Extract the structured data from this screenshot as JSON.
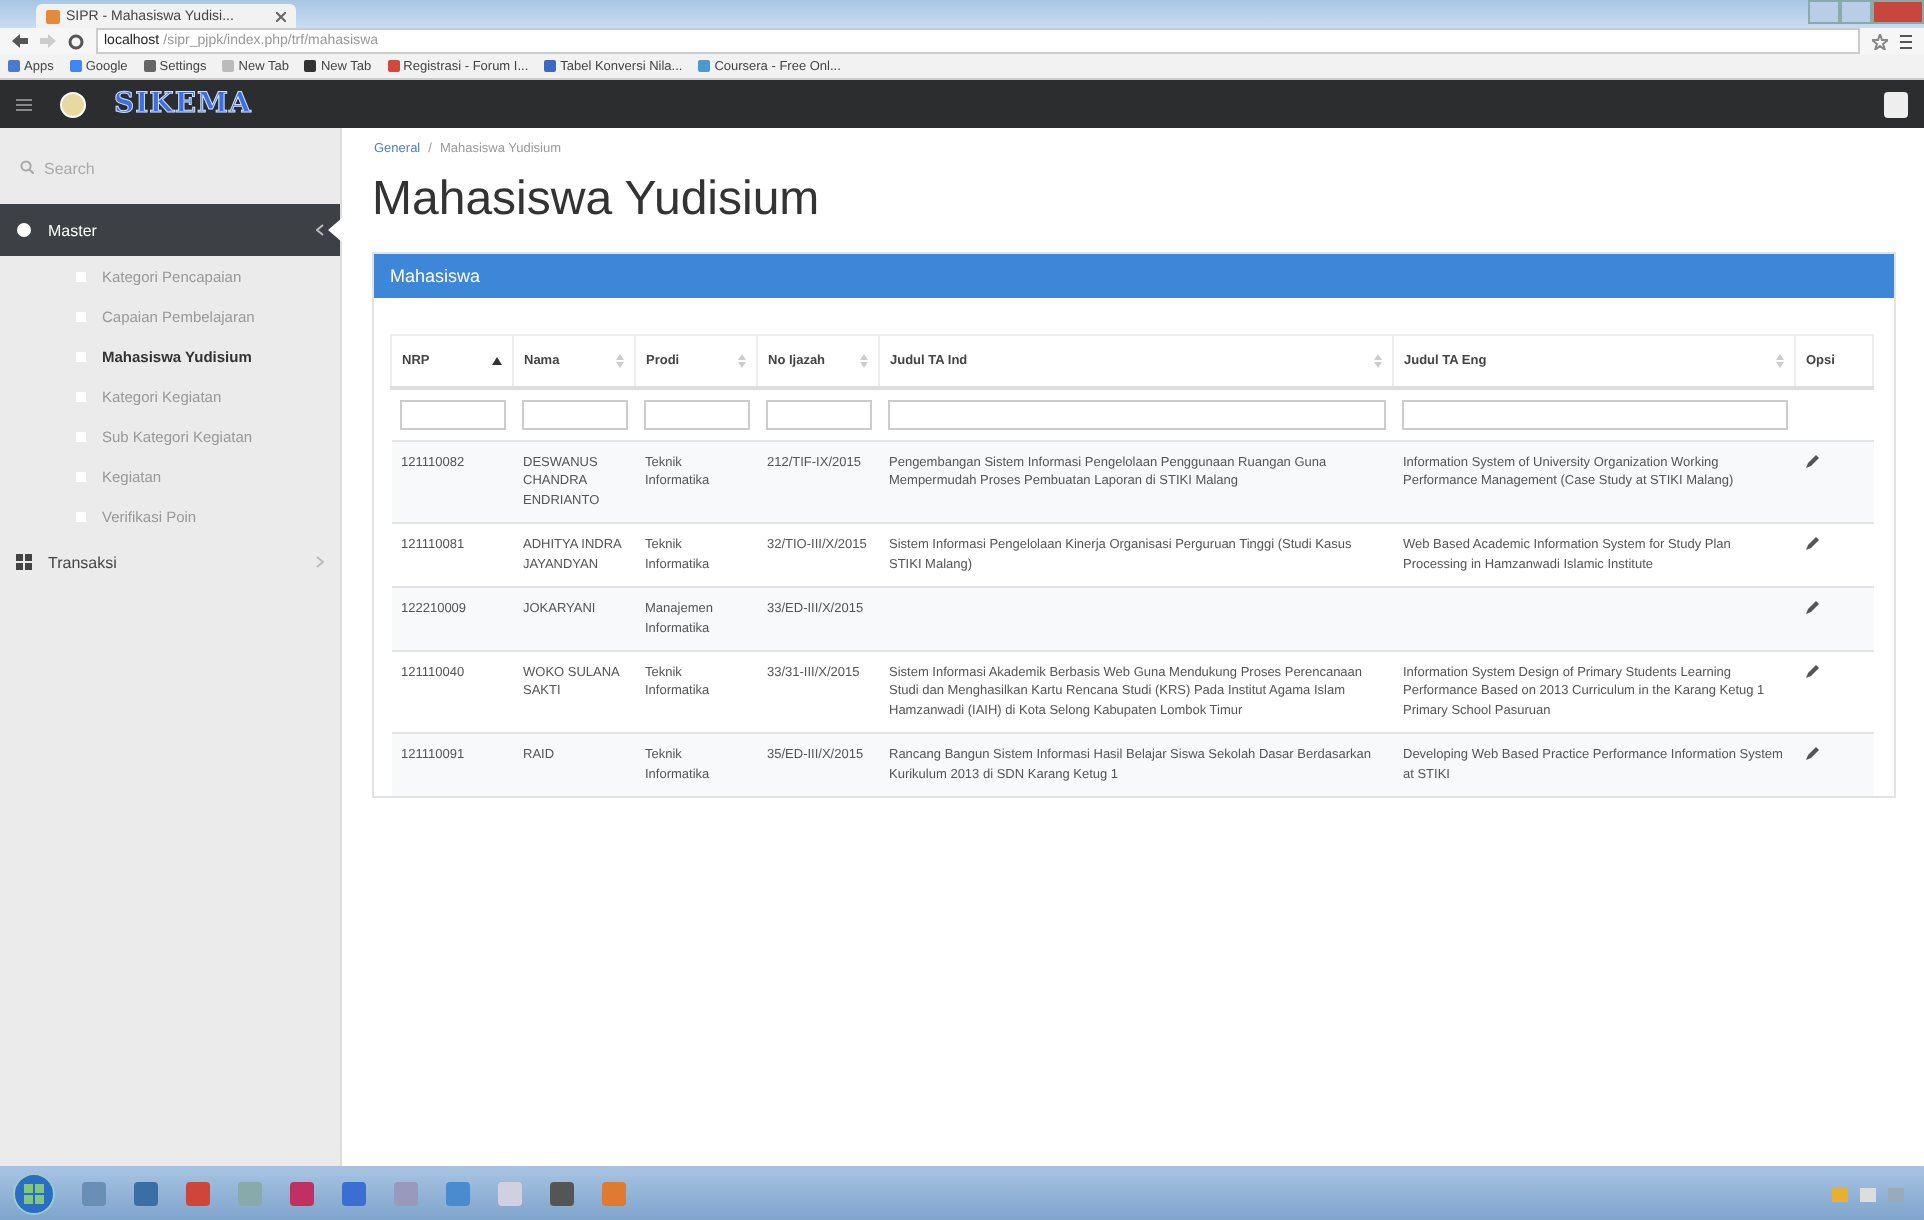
{
  "browser": {
    "tab_title": "SIPR - Mahasiswa Yudisi...",
    "url_host": "localhost",
    "url_path": "/sipr_pjpk/index.php/trf/mahasiswa",
    "bookmarks": [
      {
        "label": "Apps"
      },
      {
        "label": "Google"
      },
      {
        "label": "Settings"
      },
      {
        "label": "New Tab"
      },
      {
        "label": "New Tab"
      },
      {
        "label": "Registrasi - Forum I..."
      },
      {
        "label": "Tabel Konversi Nila..."
      },
      {
        "label": "Coursera - Free Onl..."
      }
    ]
  },
  "app": {
    "brand": "SIKEMA"
  },
  "sidebar": {
    "search_placeholder": "Search",
    "items": [
      {
        "label": "Master",
        "expanded": true,
        "selected": true,
        "children": [
          {
            "label": "Kategori Pencapaian",
            "selected": false
          },
          {
            "label": "Capaian Pembelajaran",
            "selected": false
          },
          {
            "label": "Mahasiswa Yudisium",
            "selected": true
          },
          {
            "label": "Kategori Kegiatan",
            "selected": false
          },
          {
            "label": "Sub Kategori Kegiatan",
            "selected": false
          },
          {
            "label": "Kegiatan",
            "selected": false
          },
          {
            "label": "Verifikasi Poin",
            "selected": false
          }
        ]
      },
      {
        "label": "Transaksi",
        "expanded": false,
        "selected": false
      }
    ]
  },
  "breadcrumb": [
    "General",
    "Mahasiswa Yudisium"
  ],
  "breadcrumb_separator": "/",
  "page_title": "Mahasiswa Yudisium",
  "panel_title": "Mahasiswa",
  "table": {
    "columns": [
      {
        "label": "NRP",
        "sortable": true,
        "sorted": true,
        "filter": true
      },
      {
        "label": "Nama",
        "sortable": true,
        "sorted": false,
        "filter": true
      },
      {
        "label": "Prodi",
        "sortable": true,
        "sorted": false,
        "filter": true
      },
      {
        "label": "No Ijazah",
        "sortable": true,
        "sorted": false,
        "filter": true
      },
      {
        "label": "Judul TA Ind",
        "sortable": true,
        "sorted": false,
        "filter": true
      },
      {
        "label": "Judul TA Eng",
        "sortable": true,
        "sorted": false,
        "filter": true
      },
      {
        "label": "Opsi",
        "sortable": false,
        "filter": false
      }
    ],
    "rows": [
      {
        "nrp": "121110082",
        "nama": "DESWANUS CHANDRA ENDRIANTO",
        "prodi": "Teknik Informatika",
        "no_ijazah": "212/TIF-IX/2015",
        "judul_ind": "Pengembangan Sistem Informasi Pengelolaan Penggunaan Ruangan Guna Mempermudah Proses Pembuatan Laporan di STIKI Malang",
        "judul_eng": "Information System of University Organization Working Performance Management (Case Study at STIKI Malang)"
      },
      {
        "nrp": "121110081",
        "nama": "ADHITYA INDRA JAYANDYAN",
        "prodi": "Teknik Informatika",
        "no_ijazah": "32/TIO-III/X/2015",
        "judul_ind": "Sistem Informasi Pengelolaan Kinerja Organisasi Perguruan Tinggi (Studi Kasus STIKI Malang)",
        "judul_eng": "Web Based Academic Information System for Study Plan Processing in Hamzanwadi Islamic Institute"
      },
      {
        "nrp": "122210009",
        "nama": "JOKARYANI",
        "prodi": "Manajemen Informatika",
        "no_ijazah": "33/ED-III/X/2015"
      },
      {
        "nrp": "121110040",
        "nama": "WOKO SULANA SAKTI",
        "prodi": "Teknik Informatika",
        "no_ijazah": "33/31-III/X/2015",
        "judul_ind": "Sistem Informasi Akademik Berbasis Web Guna Mendukung Proses Perencanaan Studi dan Menghasilkan Kartu Rencana Studi (KRS) Pada Institut Agama Islam Hamzanwadi (IAIH) di Kota Selong Kabupaten Lombok Timur",
        "judul_eng": "Information System Design of Primary Students Learning Performance Based on 2013 Curriculum in the Karang Ketug 1 Primary School Pasuruan"
      },
      {
        "nrp": "121110091",
        "nama": "RAID",
        "prodi": "Teknik Informatika",
        "no_ijazah": "35/ED-III/X/2015",
        "judul_ind": "Rancang Bangun Sistem Informasi Hasil Belajar Siswa Sekolah Dasar Berdasarkan Kurikulum 2013 di SDN Karang Ketug 1",
        "judul_eng": "Developing Web Based Practice Performance Information System at STIKI"
      }
    ]
  }
}
